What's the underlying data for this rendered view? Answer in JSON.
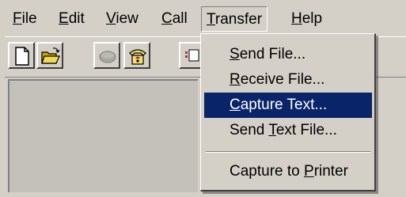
{
  "menubar": {
    "items": [
      {
        "key": "F",
        "rest": "ile"
      },
      {
        "key": "E",
        "rest": "dit"
      },
      {
        "key": "V",
        "rest": "iew"
      },
      {
        "key": "C",
        "rest": "all"
      },
      {
        "key": "T",
        "rest": "ransfer"
      },
      {
        "key": "H",
        "rest": "elp"
      }
    ]
  },
  "toolbar": {
    "buttons": [
      "new-document-icon",
      "open-folder-icon",
      "disconnect-icon",
      "phone-icon",
      "properties-icon"
    ]
  },
  "transfer_menu": {
    "items": [
      {
        "pre": "",
        "key": "S",
        "post": "end File..."
      },
      {
        "pre": "",
        "key": "R",
        "post": "eceive File..."
      },
      {
        "pre": "",
        "key": "C",
        "post": "apture Text..."
      },
      {
        "pre": "Send ",
        "key": "T",
        "post": "ext File..."
      },
      {
        "pre": "Capture to ",
        "key": "P",
        "post": "rinter"
      }
    ],
    "selected_index": 2
  },
  "colors": {
    "face": "#d4d0c8",
    "highlight": "#0a246a",
    "highlight_text": "#ffffff"
  }
}
